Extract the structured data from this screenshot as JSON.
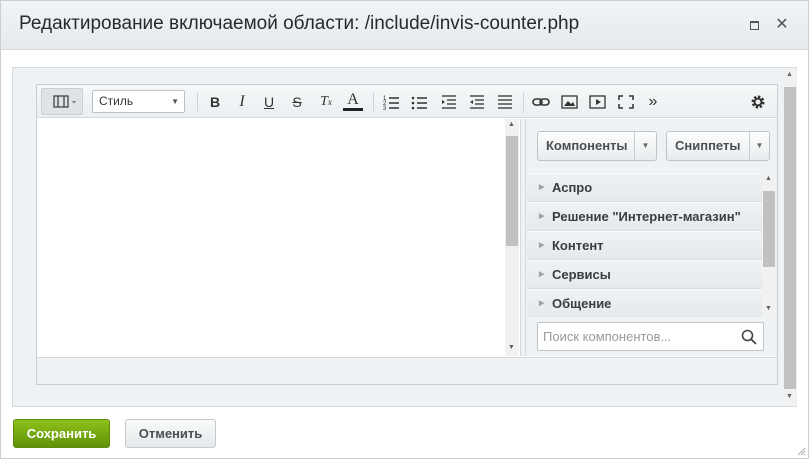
{
  "dialog": {
    "title": "Редактирование включаемой области: /include/invis-counter.php",
    "maximize_icon": "maximize-icon",
    "close_icon": "close-icon"
  },
  "toolbar": {
    "style_select_value": "Стиль",
    "buttons": [
      "bold",
      "italic",
      "underline",
      "strikethrough",
      "remove-format",
      "font-color",
      "numbered-list",
      "bulleted-list",
      "indent",
      "outdent",
      "align",
      "link",
      "image",
      "video",
      "fullscreen",
      "more",
      "settings"
    ]
  },
  "sidebar": {
    "components_label": "Компоненты",
    "snippets_label": "Сниппеты",
    "items": [
      {
        "label": "Аспро"
      },
      {
        "label": "Решение \"Интернет-магазин\""
      },
      {
        "label": "Контент"
      },
      {
        "label": "Сервисы"
      },
      {
        "label": "Общение"
      }
    ],
    "search_placeholder": "Поиск компонентов..."
  },
  "footer": {
    "save_label": "Сохранить",
    "cancel_label": "Отменить"
  },
  "colors": {
    "save_button": "#6fa60d",
    "titlebar": "#e9edef",
    "panel": "#eef2f4"
  }
}
